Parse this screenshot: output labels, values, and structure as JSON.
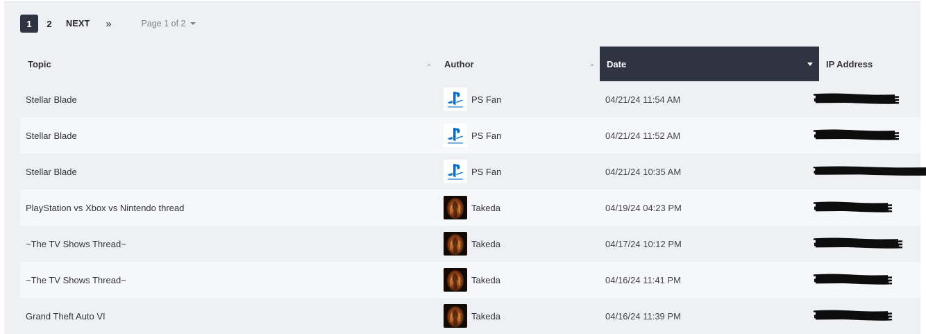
{
  "pagination": {
    "pages": [
      "1",
      "2"
    ],
    "current": "1",
    "next_label": "NEXT",
    "last_label": "»",
    "page_of": "Page 1 of 2"
  },
  "table": {
    "columns": {
      "topic": "Topic",
      "author": "Author",
      "date": "Date",
      "ip": "IP Address"
    },
    "sorted_column": "date",
    "rows": [
      {
        "topic": "Stellar Blade",
        "author": "PS Fan",
        "avatar": "playstation-logo",
        "date": "04/21/24 11:54 AM"
      },
      {
        "topic": "Stellar Blade",
        "author": "PS Fan",
        "avatar": "playstation-logo",
        "date": "04/21/24 11:52 AM"
      },
      {
        "topic": "Stellar Blade",
        "author": "PS Fan",
        "avatar": "playstation-logo",
        "date": "04/21/24 10:35 AM"
      },
      {
        "topic": "PlayStation vs Xbox vs Nintendo thread",
        "author": "Takeda",
        "avatar": "fire-warrior",
        "date": "04/19/24 04:23 PM"
      },
      {
        "topic": "~The TV Shows Thread~",
        "author": "Takeda",
        "avatar": "fire-warrior",
        "date": "04/17/24 10:12 PM"
      },
      {
        "topic": "~The TV Shows Thread~",
        "author": "Takeda",
        "avatar": "fire-warrior",
        "date": "04/16/24 11:41 PM"
      },
      {
        "topic": "Grand Theft Auto VI",
        "author": "Takeda",
        "avatar": "fire-warrior",
        "date": "04/16/24 11:39 PM"
      }
    ]
  },
  "colors": {
    "header_sorted_bg": "#2e3442",
    "row_odd": "#eef0f4",
    "row_even": "#f5f7fa",
    "playstation_blue": "#0070d1"
  }
}
